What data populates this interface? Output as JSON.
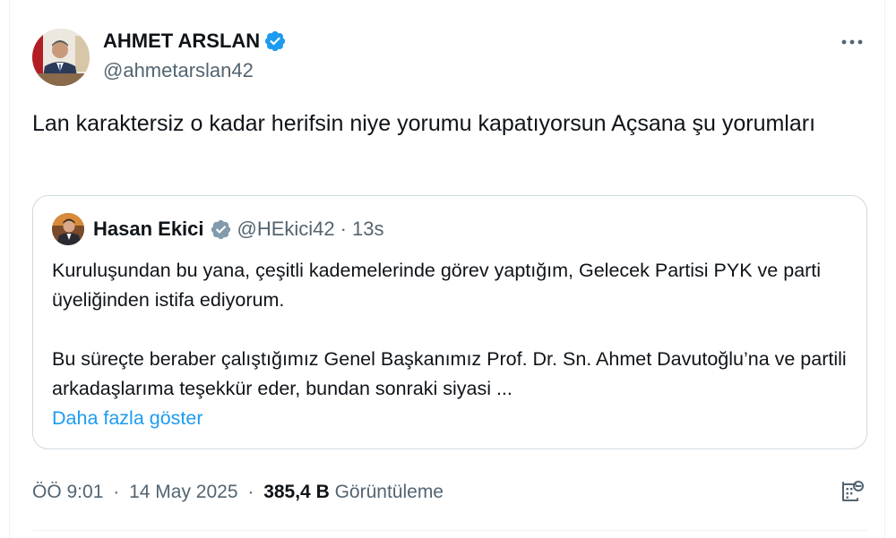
{
  "tweet": {
    "author": {
      "name": "AHMET ARSLAN",
      "handle": "@ahmetarslan42",
      "verified": true,
      "avatar_icon": "profile-photo-man-in-suit"
    },
    "more_icon": "more-horizontal-icon",
    "text": "Lan karaktersiz o kadar herifsin niye yorumu kapatıyorsun Açsana şu yorumları",
    "quote": {
      "author_name": "Hasan Ekici",
      "handle": "@HEkici42",
      "separator": "·",
      "time": "13s",
      "verified_badge": "gray-verified-badge",
      "paragraphs": [
        "Kuruluşundan bu yana, çeşitli kademelerinde görev yaptığım, Gelecek Partisi PYK ve parti üyeliğinden istifa ediyorum.",
        "Bu süreçte beraber çalıştığımız Genel Başkanımız Prof. Dr. Sn. Ahmet Davutoğlu’na ve partili arkadaşlarıma teşekkür eder, bundan sonraki siyasi ..."
      ],
      "show_more": "Daha fazla göster"
    },
    "meta": {
      "time": "ÖÖ 9:01",
      "separator": "·",
      "date": "14 May 2025",
      "views": "385,4 B",
      "views_label": "Görüntüleme"
    },
    "analytics_icon": "view-analytics-icon"
  },
  "colors": {
    "text": "#0f1419",
    "secondary": "#536471",
    "accent": "#1d9bf0",
    "border": "#cfd9de"
  }
}
